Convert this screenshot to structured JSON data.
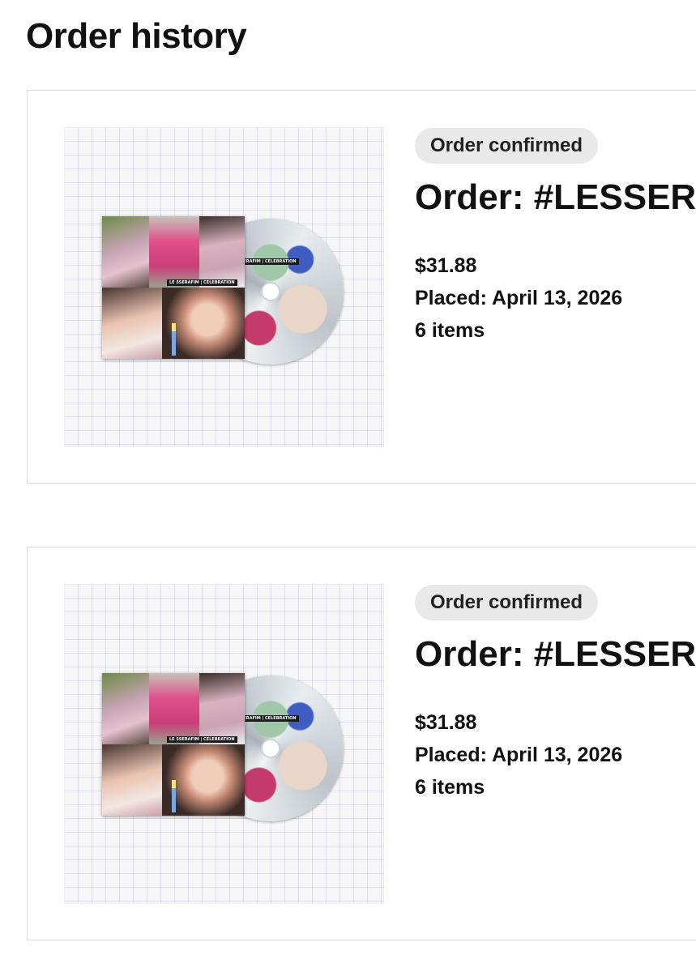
{
  "page": {
    "title": "Order history"
  },
  "orders": [
    {
      "status": "Order confirmed",
      "title": "Order: #LESSER",
      "price": "$31.88",
      "placed": "Placed: April 13, 2026",
      "items": "6 items",
      "album_label": "LE SSERAFIM | CELEBRATION",
      "disc_label": "LE SSERAFIM | CELEBRATION"
    },
    {
      "status": "Order confirmed",
      "title": "Order: #LESSER",
      "price": "$31.88",
      "placed": "Placed: April 13, 2026",
      "items": "6 items",
      "album_label": "LE SSERAFIM | CELEBRATION",
      "disc_label": "LE SSERAFIM | CELEBRATION"
    }
  ],
  "colors": {
    "badge_background": "#e9e9e9",
    "card_border": "#d9d9d9",
    "text": "#111111"
  }
}
